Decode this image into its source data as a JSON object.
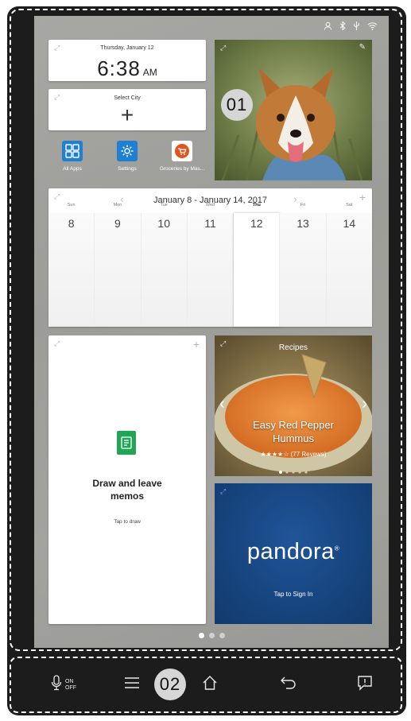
{
  "status_icons": [
    "person-icon",
    "bluetooth-icon",
    "usb-icon",
    "wifi-icon"
  ],
  "clock": {
    "date": "Thursday, January 12",
    "time": "6:38",
    "ampm": "AM"
  },
  "city": {
    "label": "Select City",
    "plus": "+"
  },
  "apps": [
    {
      "label": "All Apps",
      "icon": "grid-icon",
      "color": "#1f7fd2"
    },
    {
      "label": "Settings",
      "icon": "gear-icon",
      "color": "#1f7fd2"
    },
    {
      "label": "Groceries by Mas...",
      "icon": "cart-icon",
      "color": "#e2541f"
    }
  ],
  "photo": {
    "badge": "01"
  },
  "calendar": {
    "title": "January 8 - January 14, 2017",
    "prev": "‹",
    "next": "›",
    "plus": "+",
    "days": [
      {
        "name": "Sun",
        "date": "8"
      },
      {
        "name": "Mon",
        "date": "9"
      },
      {
        "name": "Tue",
        "date": "10"
      },
      {
        "name": "Wed",
        "date": "11"
      },
      {
        "name": "Thu",
        "date": "12"
      },
      {
        "name": "Fri",
        "date": "13"
      },
      {
        "name": "Sat",
        "date": "14"
      }
    ],
    "selected_day": "Thu"
  },
  "memo": {
    "title_line1": "Draw and leave",
    "title_line2": "memos",
    "subtitle": "Tap to draw",
    "plus": "+"
  },
  "recipe": {
    "header": "Recipes",
    "name_line1": "Easy Red Pepper",
    "name_line2": "Hummus",
    "stars": "★★★★☆",
    "reviews": "(77 Revews)"
  },
  "pandora": {
    "logo": "pandora",
    "reg": "®",
    "subtitle": "Tap to Sign In"
  },
  "navbar": {
    "mic_on": "ON",
    "mic_off": "OFF",
    "badge": "02"
  },
  "colors": {
    "device": "#1c1c1c",
    "screen": "#a2a29f",
    "pandora": "#17457f",
    "memo_green": "#22a457"
  }
}
